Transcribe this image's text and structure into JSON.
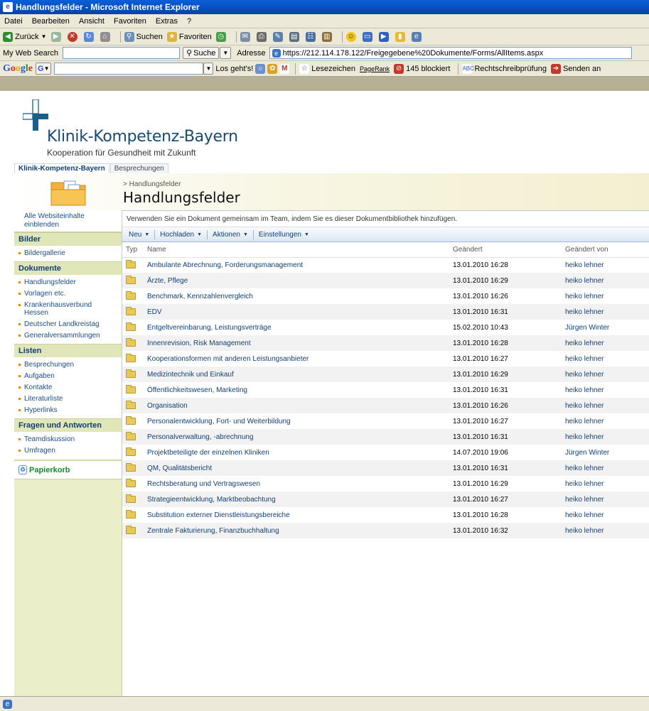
{
  "window": {
    "title": "Handlungsfelder - Microsoft Internet Explorer"
  },
  "menu": [
    "Datei",
    "Bearbeiten",
    "Ansicht",
    "Favoriten",
    "Extras",
    "?"
  ],
  "toolbar": {
    "back": "Zurück",
    "search": "Suchen",
    "favorites": "Favoriten"
  },
  "addressbar": {
    "mysearch_label": "My Web Search",
    "suche_button": "Suche",
    "address_label": "Adresse",
    "url": "https://212.114.178.122/Freigegebene%20Dokumente/Forms/AllItems.aspx"
  },
  "googlebar": {
    "go_label": "Los geht's!",
    "bookmarks": "Lesezeichen",
    "pagerank": "PageRank",
    "blocked": "145 blockiert",
    "spellcheck": "Rechtschreibprüfung",
    "send": "Senden an"
  },
  "site": {
    "name": "Klinik-Kompetenz-Bayern",
    "tagline": "Kooperation für Gesundheit mit Zukunft",
    "tabs": [
      "Klinik-Kompetenz-Bayern",
      "Besprechungen"
    ]
  },
  "page": {
    "breadcrumb": "> Handlungsfelder",
    "title": "Handlungsfelder",
    "description": "Verwenden Sie ein Dokument gemeinsam im Team, indem Sie es dieser Dokumentbibliothek hinzufügen."
  },
  "actions": [
    "Neu",
    "Hochladen",
    "Aktionen",
    "Einstellungen"
  ],
  "nav": {
    "all_content": "Alle Websiteinhalte einblenden",
    "sections": [
      {
        "heading": "Bilder",
        "items": [
          "Bildergallerie"
        ]
      },
      {
        "heading": "Dokumente",
        "items": [
          "Handlungsfelder",
          "Vorlagen etc.",
          "Krankenhausverbund Hessen",
          "Deutscher Landkreistag",
          "Generalversammlungen"
        ]
      },
      {
        "heading": "Listen",
        "items": [
          "Besprechungen",
          "Aufgaben",
          "Kontakte",
          "Literaturliste",
          "Hyperlinks"
        ]
      },
      {
        "heading": "Fragen und Antworten",
        "items": [
          "Teamdiskussion",
          "Umfragen"
        ]
      }
    ],
    "recycle_bin": "Papierkorb"
  },
  "table": {
    "columns": [
      "Typ",
      "Name",
      "Geändert",
      "Geändert von"
    ],
    "rows": [
      {
        "name": "Ambulante Abrechnung, Forderungsmanagement",
        "modified": "13.01.2010 16:28",
        "by": "heiko lehner"
      },
      {
        "name": "Ärzte, Pflege",
        "modified": "13.01.2010 16:29",
        "by": "heiko lehner"
      },
      {
        "name": "Benchmark, Kennzahlenvergleich",
        "modified": "13.01.2010 16:26",
        "by": "heiko lehner"
      },
      {
        "name": "EDV",
        "modified": "13.01.2010 16:31",
        "by": "heiko lehner"
      },
      {
        "name": "Entgeltvereinbarung, Leistungsverträge",
        "modified": "15.02.2010 10:43",
        "by": "Jürgen Winter"
      },
      {
        "name": "Innenrevision, Risk Management",
        "modified": "13.01.2010 16:28",
        "by": "heiko lehner"
      },
      {
        "name": "Kooperationsformen mit anderen Leistungsanbieter",
        "modified": "13.01.2010 16:27",
        "by": "heiko lehner"
      },
      {
        "name": "Medizintechnik und Einkauf",
        "modified": "13.01.2010 16:29",
        "by": "heiko lehner"
      },
      {
        "name": "Öffentlichkeitswesen, Marketing",
        "modified": "13.01.2010 16:31",
        "by": "heiko lehner"
      },
      {
        "name": "Organisation",
        "modified": "13.01.2010 16:26",
        "by": "heiko lehner"
      },
      {
        "name": "Personalentwicklung, Fort- und Weiterbildung",
        "modified": "13.01.2010 16:27",
        "by": "heiko lehner"
      },
      {
        "name": "Personalverwaltung, -abrechnung",
        "modified": "13.01.2010 16:31",
        "by": "heiko lehner"
      },
      {
        "name": "Projektbeteiligte der einzelnen Kliniken",
        "modified": "14.07.2010 19:06",
        "by": "Jürgen Winter"
      },
      {
        "name": "QM, Qualitätsbericht",
        "modified": "13.01.2010 16:31",
        "by": "heiko lehner"
      },
      {
        "name": "Rechtsberatung und Vertragswesen",
        "modified": "13.01.2010 16:29",
        "by": "heiko lehner"
      },
      {
        "name": "Strategieentwicklung, Marktbeobachtung",
        "modified": "13.01.2010 16:27",
        "by": "heiko lehner"
      },
      {
        "name": "Substitution externer Dienstleistungsbereiche",
        "modified": "13.01.2010 16:28",
        "by": "heiko lehner"
      },
      {
        "name": "Zentrale Fakturierung, Finanzbuchhaltung",
        "modified": "13.01.2010 16:32",
        "by": "heiko lehner"
      }
    ]
  },
  "colors": {
    "accent": "#103f77",
    "brand": "#1a4a6e",
    "nav_bg": "#ebefc9"
  }
}
